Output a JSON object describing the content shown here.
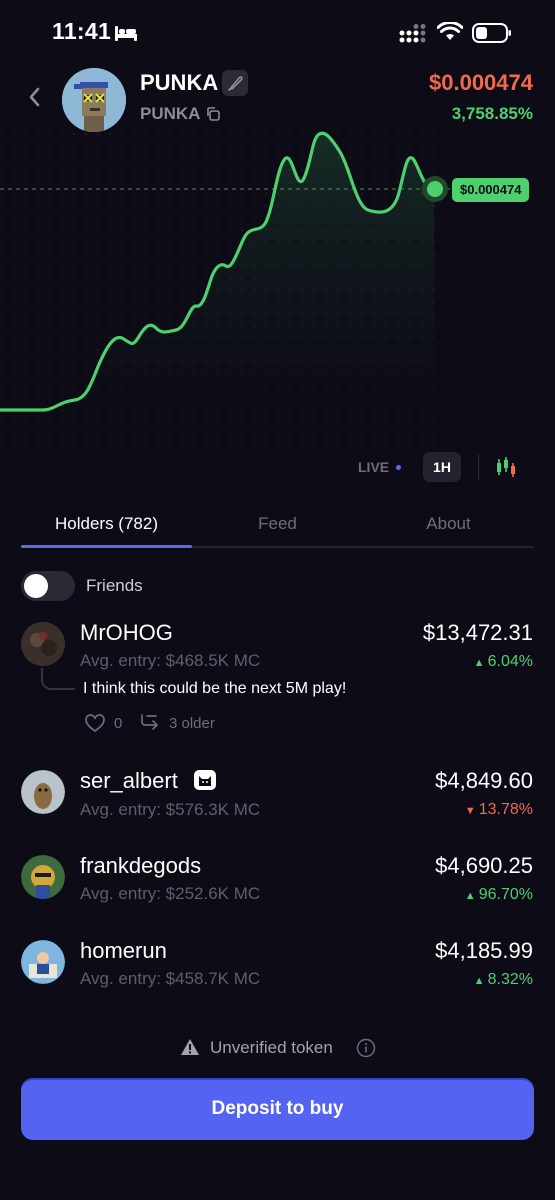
{
  "status_bar": {
    "time": "11:41"
  },
  "header": {
    "token_name": "PUNKA",
    "ticker": "PUNKA",
    "price": "$0.000474",
    "change": "3,758.85%"
  },
  "chart": {
    "price_tag": "$0.000474",
    "live_label": "LIVE",
    "timeframe": "1H",
    "colors": {
      "line": "#4ed06f",
      "price_down": "#f26a4b",
      "accent": "#5563f2"
    }
  },
  "tabs": [
    {
      "label": "Holders (782)",
      "active": true
    },
    {
      "label": "Feed",
      "active": false
    },
    {
      "label": "About",
      "active": false
    }
  ],
  "friends_toggle": {
    "label": "Friends",
    "on": false
  },
  "holders": [
    {
      "name": "MrOHOG",
      "entry": "Avg. entry: $468.5K MC",
      "value": "$13,472.31",
      "pct": "6.04%",
      "direction": "up",
      "comment": "I think this could be the next 5M play!",
      "likes": "0",
      "older": "3 older"
    },
    {
      "name": "ser_albert",
      "entry": "Avg. entry: $576.3K MC",
      "value": "$4,849.60",
      "pct": "13.78%",
      "direction": "down"
    },
    {
      "name": "frankdegods",
      "entry": "Avg. entry: $252.6K MC",
      "value": "$4,690.25",
      "pct": "96.70%",
      "direction": "up"
    },
    {
      "name": "homerun",
      "entry": "Avg. entry: $458.7K MC",
      "value": "$4,185.99",
      "pct": "8.32%",
      "direction": "up"
    }
  ],
  "footer": {
    "unverified_label": "Unverified token",
    "deposit_label": "Deposit to buy"
  }
}
